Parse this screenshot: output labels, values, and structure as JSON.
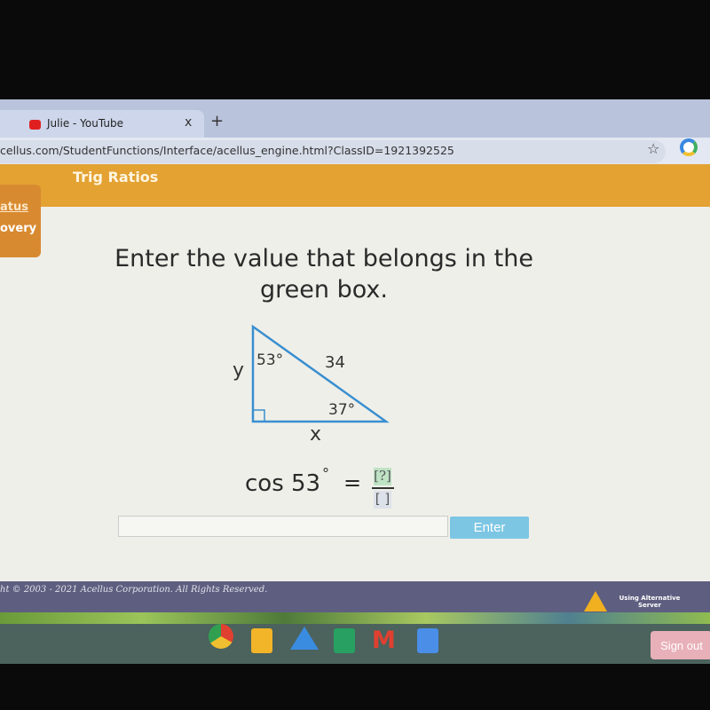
{
  "browser": {
    "tab_close_prev": "x",
    "tab_title": "Julie - YouTube",
    "tab_close": "x",
    "new_tab": "+",
    "url": "cellus.com/StudentFunctions/Interface/acellus_engine.html?ClassID=1921392525",
    "bookmark_icon": "star-icon",
    "extension_icon": "extension-icon"
  },
  "header": {
    "title": "Trig Ratios"
  },
  "sidebar": {
    "items": [
      {
        "label": "atus"
      },
      {
        "label": "overy"
      }
    ]
  },
  "question": {
    "prompt_line1": "Enter the value that belongs in the",
    "prompt_line2": "green box.",
    "triangle": {
      "side_y": "y",
      "side_x": "x",
      "hypotenuse": "34",
      "angle_top": "53°",
      "angle_right": "37°",
      "color": "#3a8fd0"
    },
    "equation": {
      "lhs": "cos 53",
      "degree": "°",
      "equals": "=",
      "numerator": "[?]",
      "denominator": "[ ]",
      "numerator_color": "#bfe3c5"
    },
    "answer_value": "",
    "enter_label": "Enter"
  },
  "footer": {
    "copyright": "ht © 2003 - 2021 Acellus Corporation.  All Rights Reserved.",
    "server_status": "Using Alternative Server",
    "warning_icon": "warning-icon"
  },
  "shelf": {
    "apps": [
      "chrome-icon",
      "slides-icon",
      "drive-icon",
      "sheets-icon",
      "gmail-icon",
      "docs-icon"
    ],
    "sign_out": "Sign out"
  },
  "colors": {
    "orange": "#e3a232",
    "footer": "#5e5f80",
    "enter_button": "#7cc6e4"
  }
}
